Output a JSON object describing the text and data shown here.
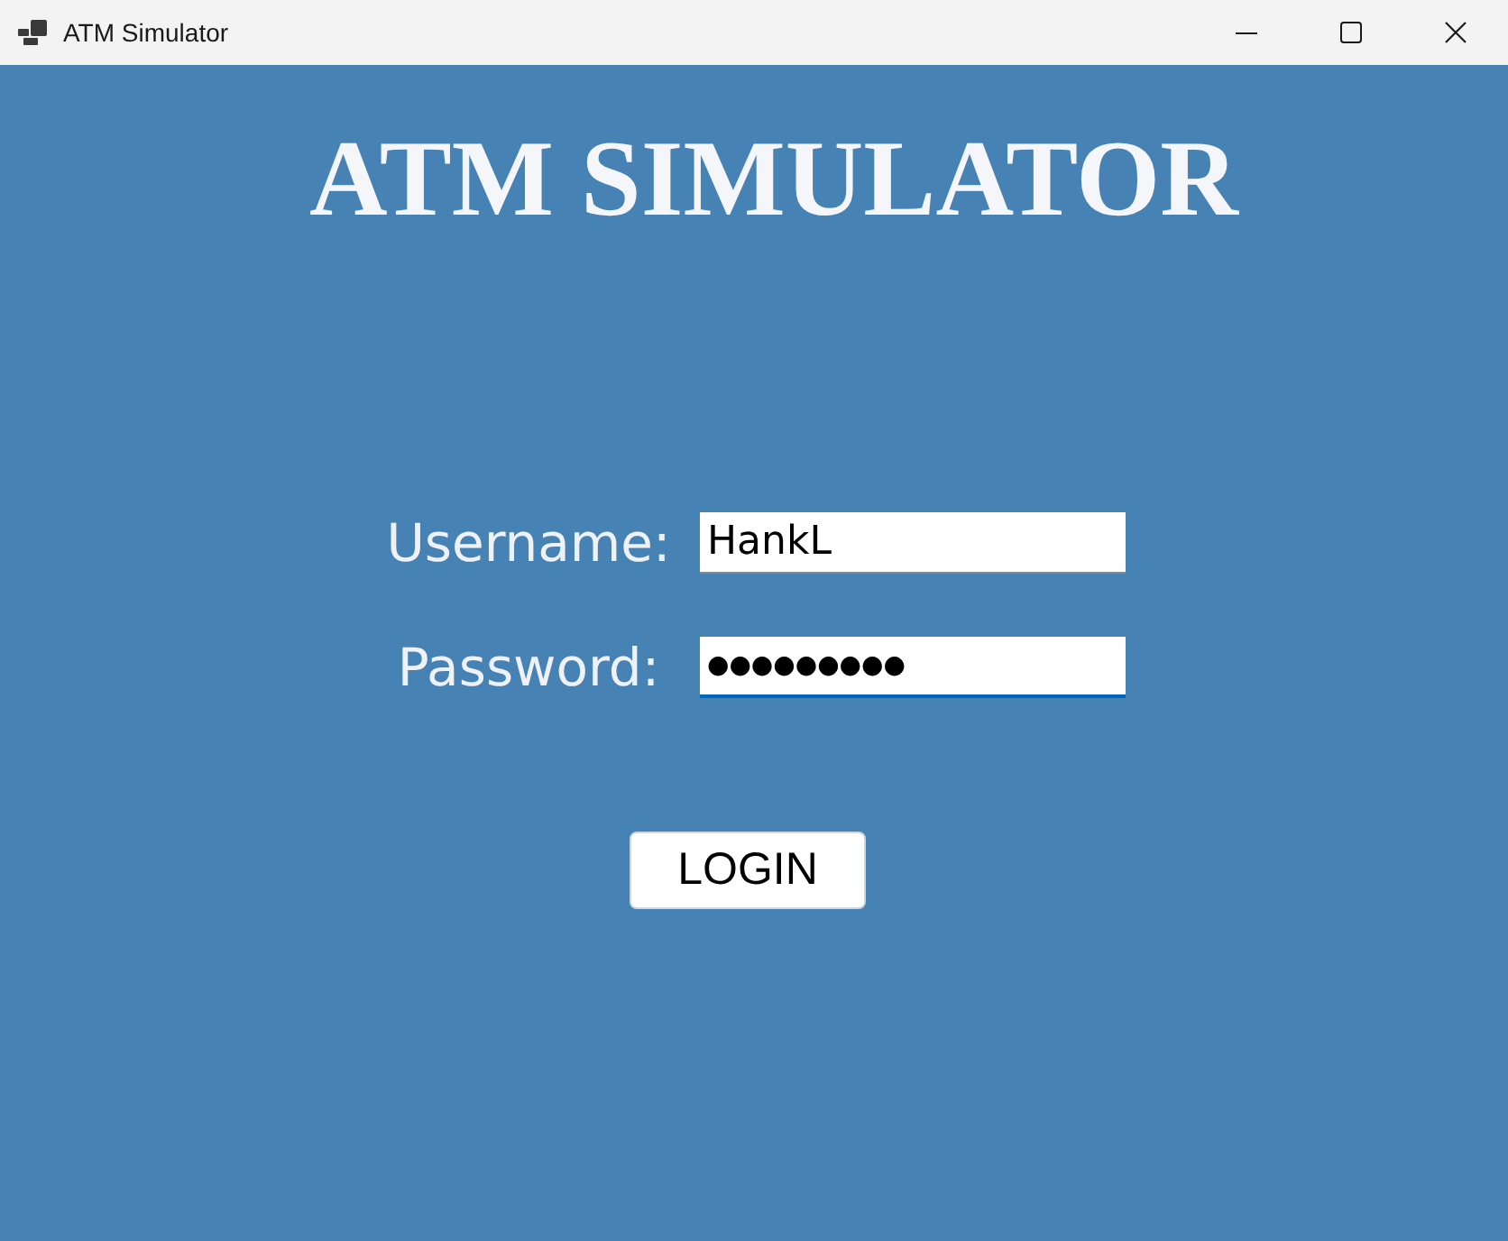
{
  "window": {
    "title": "ATM Simulator"
  },
  "heading": "ATM SIMULATOR",
  "fields": [
    {
      "kind": "text",
      "label": "Username:",
      "value": "HankL",
      "focused": false
    },
    {
      "kind": "password",
      "label": "Password:",
      "value": "●●●●●●●●●",
      "focused": true
    }
  ],
  "button": "LOGIN"
}
